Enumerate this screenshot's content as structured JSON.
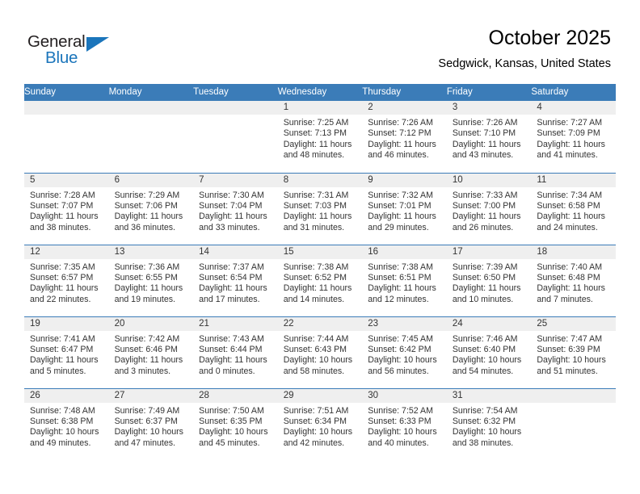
{
  "brand": {
    "name_part1": "General",
    "name_part2": "Blue",
    "triangle_color": "#1b75bb"
  },
  "header": {
    "title": "October 2025",
    "subtitle": "Sedgwick, Kansas, United States",
    "header_bg": "#3b7cb8"
  },
  "calendar": {
    "weekday_headers": [
      "Sunday",
      "Monday",
      "Tuesday",
      "Wednesday",
      "Thursday",
      "Friday",
      "Saturday"
    ],
    "weeks": [
      [
        {
          "day": "",
          "lines": []
        },
        {
          "day": "",
          "lines": []
        },
        {
          "day": "",
          "lines": []
        },
        {
          "day": "1",
          "lines": [
            "Sunrise: 7:25 AM",
            "Sunset: 7:13 PM",
            "Daylight: 11 hours",
            "and 48 minutes."
          ]
        },
        {
          "day": "2",
          "lines": [
            "Sunrise: 7:26 AM",
            "Sunset: 7:12 PM",
            "Daylight: 11 hours",
            "and 46 minutes."
          ]
        },
        {
          "day": "3",
          "lines": [
            "Sunrise: 7:26 AM",
            "Sunset: 7:10 PM",
            "Daylight: 11 hours",
            "and 43 minutes."
          ]
        },
        {
          "day": "4",
          "lines": [
            "Sunrise: 7:27 AM",
            "Sunset: 7:09 PM",
            "Daylight: 11 hours",
            "and 41 minutes."
          ]
        }
      ],
      [
        {
          "day": "5",
          "lines": [
            "Sunrise: 7:28 AM",
            "Sunset: 7:07 PM",
            "Daylight: 11 hours",
            "and 38 minutes."
          ]
        },
        {
          "day": "6",
          "lines": [
            "Sunrise: 7:29 AM",
            "Sunset: 7:06 PM",
            "Daylight: 11 hours",
            "and 36 minutes."
          ]
        },
        {
          "day": "7",
          "lines": [
            "Sunrise: 7:30 AM",
            "Sunset: 7:04 PM",
            "Daylight: 11 hours",
            "and 33 minutes."
          ]
        },
        {
          "day": "8",
          "lines": [
            "Sunrise: 7:31 AM",
            "Sunset: 7:03 PM",
            "Daylight: 11 hours",
            "and 31 minutes."
          ]
        },
        {
          "day": "9",
          "lines": [
            "Sunrise: 7:32 AM",
            "Sunset: 7:01 PM",
            "Daylight: 11 hours",
            "and 29 minutes."
          ]
        },
        {
          "day": "10",
          "lines": [
            "Sunrise: 7:33 AM",
            "Sunset: 7:00 PM",
            "Daylight: 11 hours",
            "and 26 minutes."
          ]
        },
        {
          "day": "11",
          "lines": [
            "Sunrise: 7:34 AM",
            "Sunset: 6:58 PM",
            "Daylight: 11 hours",
            "and 24 minutes."
          ]
        }
      ],
      [
        {
          "day": "12",
          "lines": [
            "Sunrise: 7:35 AM",
            "Sunset: 6:57 PM",
            "Daylight: 11 hours",
            "and 22 minutes."
          ]
        },
        {
          "day": "13",
          "lines": [
            "Sunrise: 7:36 AM",
            "Sunset: 6:55 PM",
            "Daylight: 11 hours",
            "and 19 minutes."
          ]
        },
        {
          "day": "14",
          "lines": [
            "Sunrise: 7:37 AM",
            "Sunset: 6:54 PM",
            "Daylight: 11 hours",
            "and 17 minutes."
          ]
        },
        {
          "day": "15",
          "lines": [
            "Sunrise: 7:38 AM",
            "Sunset: 6:52 PM",
            "Daylight: 11 hours",
            "and 14 minutes."
          ]
        },
        {
          "day": "16",
          "lines": [
            "Sunrise: 7:38 AM",
            "Sunset: 6:51 PM",
            "Daylight: 11 hours",
            "and 12 minutes."
          ]
        },
        {
          "day": "17",
          "lines": [
            "Sunrise: 7:39 AM",
            "Sunset: 6:50 PM",
            "Daylight: 11 hours",
            "and 10 minutes."
          ]
        },
        {
          "day": "18",
          "lines": [
            "Sunrise: 7:40 AM",
            "Sunset: 6:48 PM",
            "Daylight: 11 hours",
            "and 7 minutes."
          ]
        }
      ],
      [
        {
          "day": "19",
          "lines": [
            "Sunrise: 7:41 AM",
            "Sunset: 6:47 PM",
            "Daylight: 11 hours",
            "and 5 minutes."
          ]
        },
        {
          "day": "20",
          "lines": [
            "Sunrise: 7:42 AM",
            "Sunset: 6:46 PM",
            "Daylight: 11 hours",
            "and 3 minutes."
          ]
        },
        {
          "day": "21",
          "lines": [
            "Sunrise: 7:43 AM",
            "Sunset: 6:44 PM",
            "Daylight: 11 hours",
            "and 0 minutes."
          ]
        },
        {
          "day": "22",
          "lines": [
            "Sunrise: 7:44 AM",
            "Sunset: 6:43 PM",
            "Daylight: 10 hours",
            "and 58 minutes."
          ]
        },
        {
          "day": "23",
          "lines": [
            "Sunrise: 7:45 AM",
            "Sunset: 6:42 PM",
            "Daylight: 10 hours",
            "and 56 minutes."
          ]
        },
        {
          "day": "24",
          "lines": [
            "Sunrise: 7:46 AM",
            "Sunset: 6:40 PM",
            "Daylight: 10 hours",
            "and 54 minutes."
          ]
        },
        {
          "day": "25",
          "lines": [
            "Sunrise: 7:47 AM",
            "Sunset: 6:39 PM",
            "Daylight: 10 hours",
            "and 51 minutes."
          ]
        }
      ],
      [
        {
          "day": "26",
          "lines": [
            "Sunrise: 7:48 AM",
            "Sunset: 6:38 PM",
            "Daylight: 10 hours",
            "and 49 minutes."
          ]
        },
        {
          "day": "27",
          "lines": [
            "Sunrise: 7:49 AM",
            "Sunset: 6:37 PM",
            "Daylight: 10 hours",
            "and 47 minutes."
          ]
        },
        {
          "day": "28",
          "lines": [
            "Sunrise: 7:50 AM",
            "Sunset: 6:35 PM",
            "Daylight: 10 hours",
            "and 45 minutes."
          ]
        },
        {
          "day": "29",
          "lines": [
            "Sunrise: 7:51 AM",
            "Sunset: 6:34 PM",
            "Daylight: 10 hours",
            "and 42 minutes."
          ]
        },
        {
          "day": "30",
          "lines": [
            "Sunrise: 7:52 AM",
            "Sunset: 6:33 PM",
            "Daylight: 10 hours",
            "and 40 minutes."
          ]
        },
        {
          "day": "31",
          "lines": [
            "Sunrise: 7:54 AM",
            "Sunset: 6:32 PM",
            "Daylight: 10 hours",
            "and 38 minutes."
          ]
        },
        {
          "day": "",
          "lines": []
        }
      ]
    ]
  }
}
